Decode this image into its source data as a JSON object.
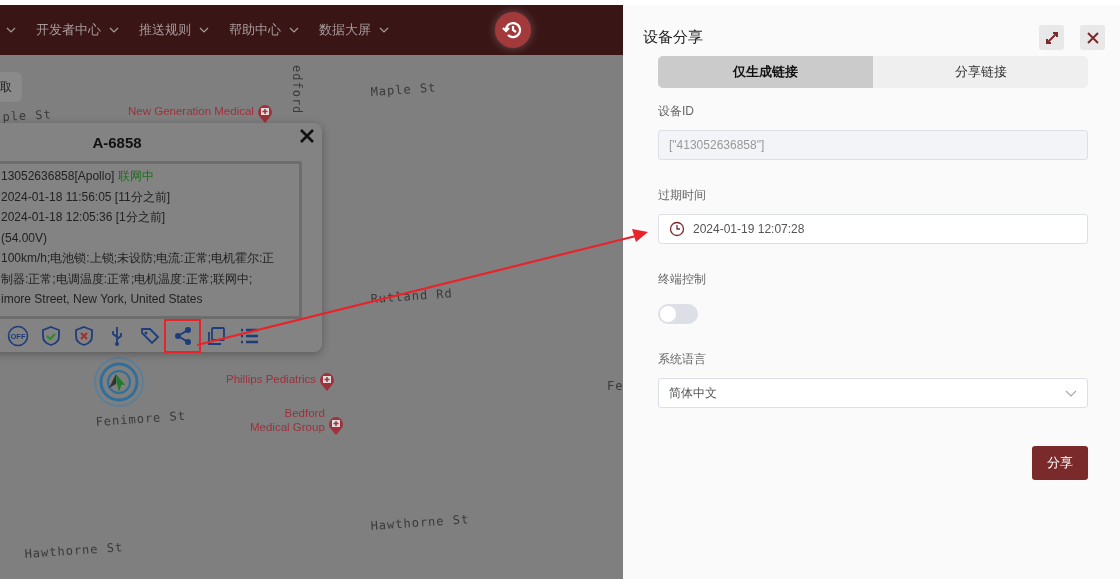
{
  "navbar": {
    "items": [
      {
        "label": "开发者中心"
      },
      {
        "label": "推送规则"
      },
      {
        "label": "帮助中心"
      },
      {
        "label": "数据大屏"
      }
    ]
  },
  "map": {
    "button": "取",
    "labels": [
      {
        "kind": "street",
        "text": "Maple St"
      },
      {
        "kind": "street",
        "text": "ple St"
      },
      {
        "kind": "street",
        "text": "edford"
      },
      {
        "kind": "poi",
        "text": "New Generation Medical"
      },
      {
        "kind": "street",
        "text": "Rutland Rd"
      },
      {
        "kind": "poi",
        "text": "Phillips Pediatrics"
      },
      {
        "kind": "poi",
        "text": "Bedford\nMedical Group"
      },
      {
        "kind": "street",
        "text": "Fenimore St"
      },
      {
        "kind": "street",
        "text": "Fe"
      },
      {
        "kind": "street",
        "text": "Hawthorne St"
      },
      {
        "kind": "street",
        "text": "Hawthorne St"
      }
    ]
  },
  "popup": {
    "title": "A-6858",
    "lines": [
      {
        "text": "13052636858[Apollo] ",
        "status": "联网中"
      },
      {
        "text": "2024-01-18 11:56:05 [11分之前]"
      },
      {
        "text": "2024-01-18 12:05:36 [1分之前]"
      },
      {
        "text": "(54.00V)"
      },
      {
        "text": "100km/h;电池锁:上锁;未设防;电流:正常;电机霍尔:正"
      },
      {
        "text": "制器:正常;电调温度:正常;电机温度:正常;联网中;"
      },
      {
        "text": "imore Street, New York, United States"
      }
    ],
    "tools": [
      {
        "kind": "off",
        "label": "OFF"
      },
      {
        "kind": "shield-check"
      },
      {
        "kind": "shield-x"
      },
      {
        "kind": "usb"
      },
      {
        "kind": "tag"
      },
      {
        "kind": "share",
        "highlighted": true
      },
      {
        "kind": "copy"
      },
      {
        "kind": "list"
      }
    ]
  },
  "panel": {
    "title": "设备分享",
    "tabs": [
      {
        "label": "仅生成链接",
        "selected": true
      },
      {
        "label": "分享链接",
        "selected": false
      }
    ],
    "device_id": {
      "label": "设备ID",
      "value": "[\"413052636858\"]"
    },
    "expiry": {
      "label": "过期时间",
      "value": "2024-01-19 12:07:28"
    },
    "terminal_control": {
      "label": "终端控制",
      "on": false
    },
    "language": {
      "label": "系统语言",
      "value": "简体中文"
    },
    "submit": "分享"
  }
}
